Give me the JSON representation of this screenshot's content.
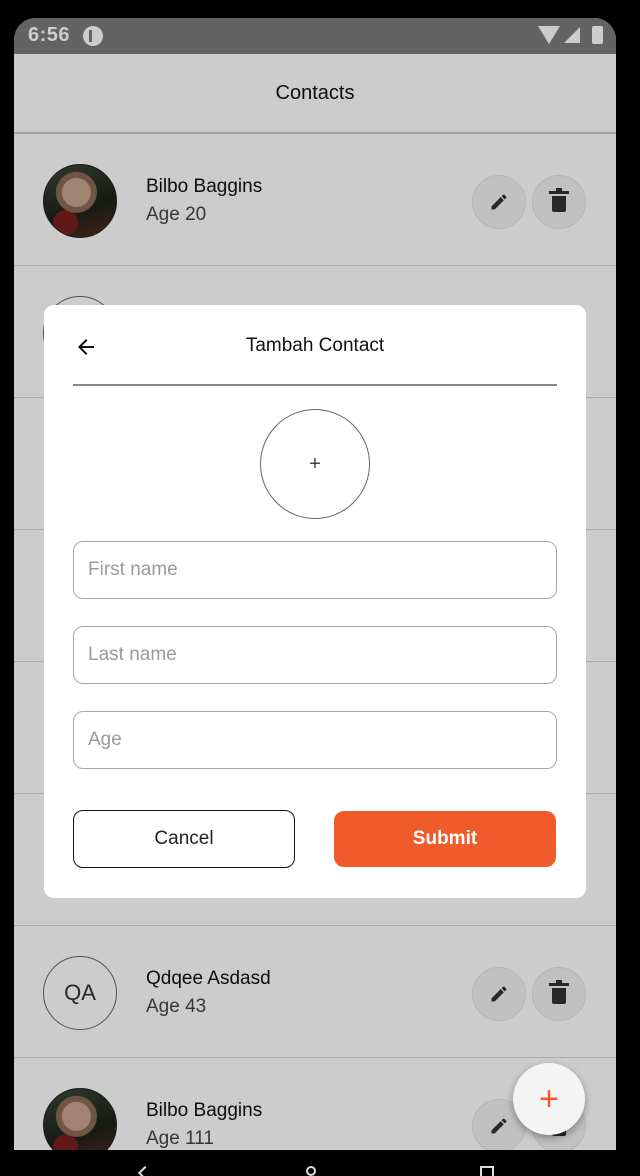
{
  "status_bar": {
    "time": "6:56"
  },
  "app_bar": {
    "title": "Contacts"
  },
  "contacts": [
    {
      "name": "Bilbo Baggins",
      "age": "Age 20",
      "avatar": "photo"
    },
    {
      "name": "",
      "age": "",
      "avatar": "initials",
      "initials": ""
    },
    {
      "name": "",
      "age": "",
      "avatar": ""
    },
    {
      "name": "",
      "age": "",
      "avatar": ""
    },
    {
      "name": "",
      "age": "",
      "avatar": ""
    },
    {
      "name": "",
      "age": "",
      "avatar": ""
    },
    {
      "name": "Qdqee Asdasd",
      "age": "Age 43",
      "avatar": "initials",
      "initials": "QA"
    },
    {
      "name": "Bilbo Baggins",
      "age": "Age 111",
      "avatar": "photo"
    }
  ],
  "dialog": {
    "title": "Tambah Contact",
    "photo_placeholder": "+",
    "first_name_placeholder": "First name",
    "last_name_placeholder": "Last name",
    "age_placeholder": "Age",
    "cancel_label": "Cancel",
    "submit_label": "Submit"
  },
  "fab": {
    "label": "+"
  },
  "colors": {
    "accent": "#ef5b2b",
    "status_bar": "#7c7c7c"
  },
  "icons": [
    "back-arrow-icon",
    "pencil-icon",
    "trash-icon",
    "plus-icon",
    "wifi-icon",
    "signal-icon",
    "battery-icon"
  ]
}
